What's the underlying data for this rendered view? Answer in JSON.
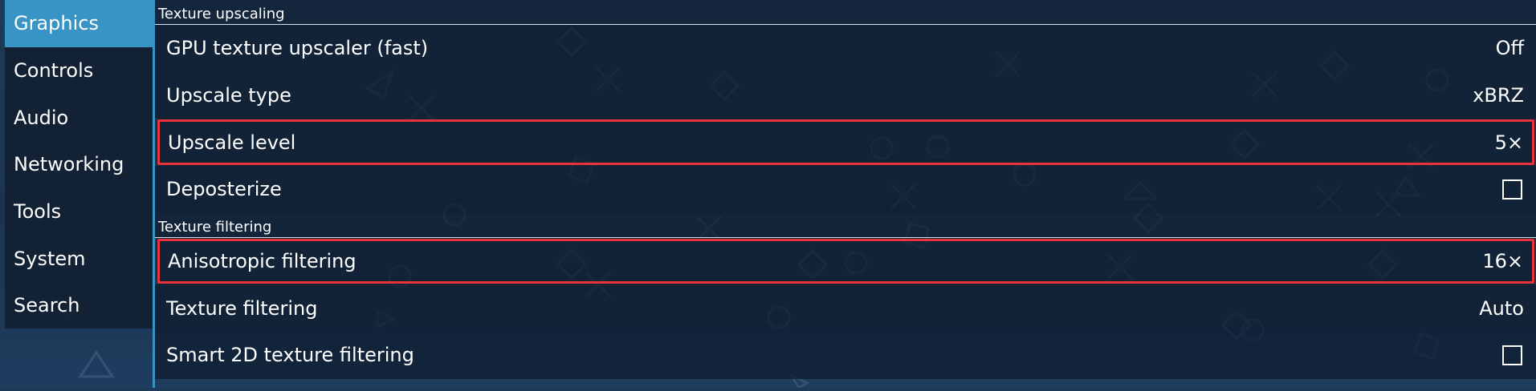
{
  "sidebar": {
    "items": [
      {
        "label": "Graphics",
        "active": true
      },
      {
        "label": "Controls",
        "active": false
      },
      {
        "label": "Audio",
        "active": false
      },
      {
        "label": "Networking",
        "active": false
      },
      {
        "label": "Tools",
        "active": false
      },
      {
        "label": "System",
        "active": false
      },
      {
        "label": "Search",
        "active": false
      }
    ]
  },
  "sections": [
    {
      "title": "Texture upscaling",
      "settings": [
        {
          "label": "GPU texture upscaler (fast)",
          "value": "Off",
          "type": "choice"
        },
        {
          "label": "Upscale type",
          "value": "xBRZ",
          "type": "choice"
        },
        {
          "label": "Upscale level",
          "value": "5×",
          "type": "choice",
          "highlighted": true
        },
        {
          "label": "Deposterize",
          "checked": false,
          "type": "checkbox"
        }
      ]
    },
    {
      "title": "Texture filtering",
      "settings": [
        {
          "label": "Anisotropic filtering",
          "value": "16×",
          "type": "choice",
          "highlighted": true
        },
        {
          "label": "Texture filtering",
          "value": "Auto",
          "type": "choice"
        },
        {
          "label": "Smart 2D texture filtering",
          "checked": false,
          "type": "checkbox"
        }
      ]
    }
  ],
  "colors": {
    "accent": "#3794c4",
    "highlight": "#e8333c",
    "background": "#1f3a58"
  }
}
